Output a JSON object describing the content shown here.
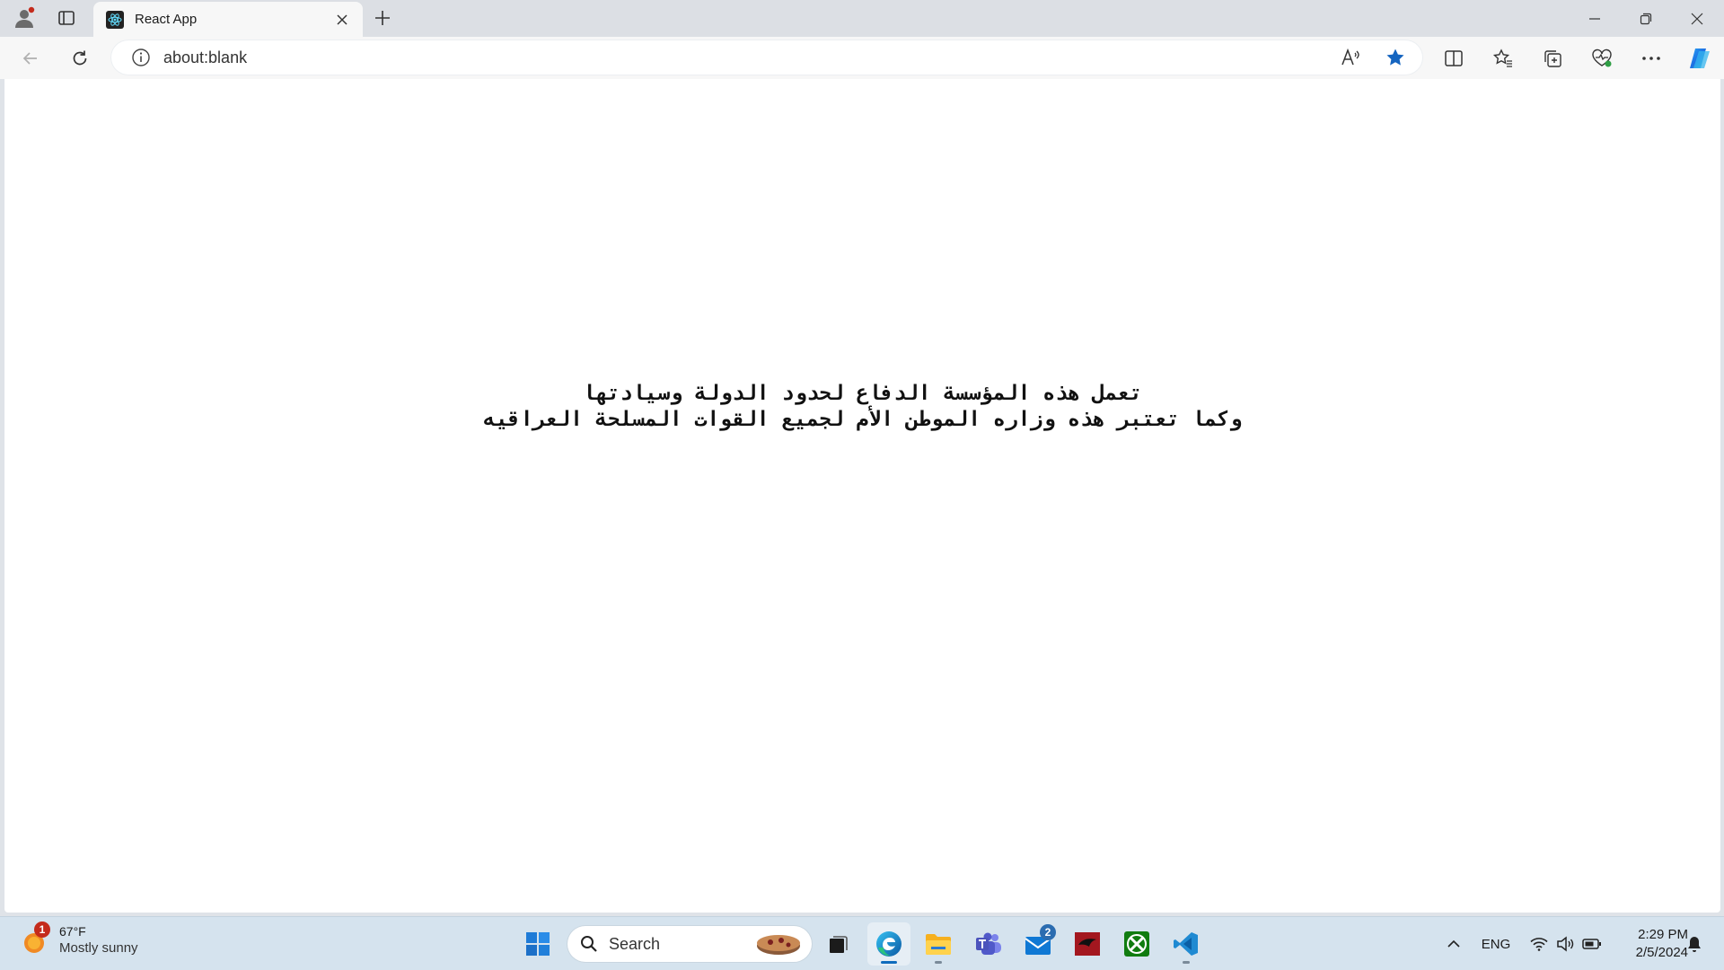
{
  "browser": {
    "tab": {
      "title": "React App",
      "favicon": "react-logo-icon"
    },
    "address_bar": {
      "url": "about:blank"
    },
    "colors": {
      "accent": "#1a73e8",
      "favorite_star": "#1565c0"
    }
  },
  "page": {
    "lines": [
      "تعمل هذه المؤسسة الدفاع لحدود الدولة وسيادتها",
      "وكما تعتبر هذه وزاره الموطن الأم لجميع القوات المسلحة العراقيه"
    ]
  },
  "taskbar": {
    "weather": {
      "temp": "67°F",
      "desc": "Mostly sunny",
      "badge": "1"
    },
    "search": {
      "label": "Search"
    },
    "mail_badge": "2",
    "tray": {
      "language": "ENG"
    },
    "clock": {
      "time": "2:29 PM",
      "date": "2/5/2024"
    }
  }
}
